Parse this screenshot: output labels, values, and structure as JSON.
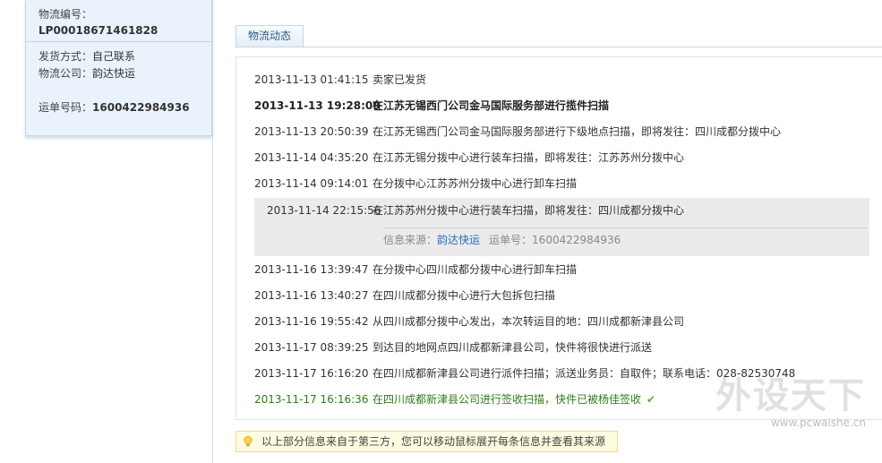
{
  "order": {
    "number_label": "物流编号：",
    "number_value": "LP00018671461828",
    "ship_method_label": "发货方式：",
    "ship_method_value": "自己联系",
    "company_label": "物流公司：",
    "company_value": "韵达快运",
    "waybill_label": "运单号码：",
    "waybill_value": "1600422984936"
  },
  "tabs": [
    {
      "label": "物流动态"
    }
  ],
  "events": [
    {
      "time": "2013-11-13 01:41:15",
      "desc": "卖家已发货"
    },
    {
      "time": "2013-11-13 19:28:09",
      "desc": "在江苏无锡西门公司金马国际服务部进行揽件扫描"
    },
    {
      "time": "2013-11-13 20:50:39",
      "desc": "在江苏无锡西门公司金马国际服务部进行下级地点扫描，即将发往：四川成都分拨中心"
    },
    {
      "time": "2013-11-14 04:35:20",
      "desc": "在江苏无锡分拨中心进行装车扫描，即将发往：江苏苏州分拨中心"
    },
    {
      "time": "2013-11-14 09:14:01",
      "desc": "在分拨中心江苏苏州分拨中心进行卸车扫描"
    },
    {
      "time": "2013-11-14 22:15:56",
      "desc": "在江苏苏州分拨中心进行装车扫描，即将发往：四川成都分拨中心"
    },
    {
      "time": "2013-11-16 13:39:47",
      "desc": "在分拨中心四川成都分拨中心进行卸车扫描"
    },
    {
      "time": "2013-11-16 13:40:27",
      "desc": "在四川成都分拨中心进行大包拆包扫描"
    },
    {
      "time": "2013-11-16 19:55:42",
      "desc": "从四川成都分拨中心发出，本次转运目的地：四川成都新津县公司"
    },
    {
      "time": "2013-11-17 08:39:25",
      "desc": "到达目的地网点四川成都新津县公司，快件将很快进行派送"
    },
    {
      "time": "2013-11-17 16:16:20",
      "desc": "在四川成都新津县公司进行派件扫描；派送业务员：自取件；联系电话：028-82530748"
    },
    {
      "time": "2013-11-17 16:16:36",
      "desc": "在四川成都新津县公司进行签收扫描，快件已被杨佳签收"
    }
  ],
  "source_info": {
    "source_label": "信息来源：",
    "source_link": "韵达快运",
    "waybill_label": "运单号：",
    "waybill_value": "1600422984936"
  },
  "notice": {
    "text": "以上部分信息来自于第三方，您可以移动鼠标展开每条信息并查看其来源",
    "icon": "lightbulb-icon"
  },
  "watermark": {
    "title": "外设天下",
    "url": "www.pcwaishe.cn"
  },
  "colors": {
    "accent_blue": "#2a6ebb",
    "success_green": "#2e7d1a",
    "panel_bg": "#eaf2fb",
    "highlight_bg": "#ebebeb",
    "notice_bg": "#fffbe0"
  }
}
